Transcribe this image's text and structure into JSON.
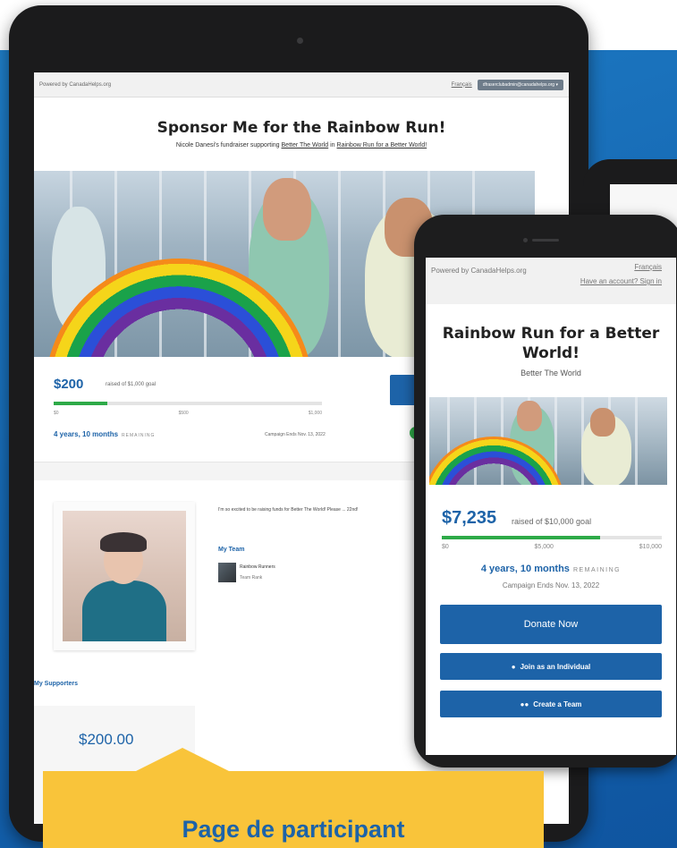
{
  "tablet": {
    "topbar": {
      "powered": "Powered by CanadaHelps.org",
      "language": "Français",
      "account": "dfraserclubadmin@canadahelps.org"
    },
    "title": "Sponsor Me for the Rainbow Run!",
    "subtitle_prefix": "Nicole Danesi's fundraiser supporting",
    "charity": "Better The World",
    "subtitle_mid": "in",
    "campaign": "Rainbow Run for a Better World!",
    "amount": "$200",
    "raised_of": "raised of $1,000 goal",
    "progress_fraction": 0.2,
    "ticks": [
      "$0",
      "$500",
      "$1,000"
    ],
    "remaining": "4 years, 10 months",
    "remaining_label": "REMAINING",
    "ends": "Campaign Ends Nov. 13, 2022",
    "bio": "I'm so excited to be raising funds for Better The World! Please ... 22nd!",
    "team_title": "My Team",
    "team_name": "Rainbow Runners",
    "team_link": "Team Rank",
    "supporters_title": "My Supporters",
    "supporter_amount": "$200.00"
  },
  "phone": {
    "powered": "Powered by CanadaHelps.org",
    "language": "Français",
    "signin": "Have an account? Sign in",
    "title": "Rainbow Run for a Better World!",
    "charity": "Better The World",
    "amount": "$7,235",
    "raised_of": "raised of $10,000 goal",
    "progress_fraction": 0.72,
    "ticks": [
      "$0",
      "$5,000",
      "$10,000"
    ],
    "remaining": "4 years, 10 months",
    "remaining_label": "REMAINING",
    "ends": "Campaign Ends Nov. 13, 2022",
    "donate": "Donate Now",
    "join": "Join as an Individual",
    "create_team": "Create a Team"
  },
  "callout": {
    "text": "Page de participant"
  },
  "colors": {
    "primary_blue": "#1d63a8",
    "progress_green": "#2eaa48",
    "callout_yellow": "#f9c43a",
    "background_blue": "#1565b0"
  },
  "icons": {
    "user": "user-icon",
    "team": "team-icon"
  }
}
